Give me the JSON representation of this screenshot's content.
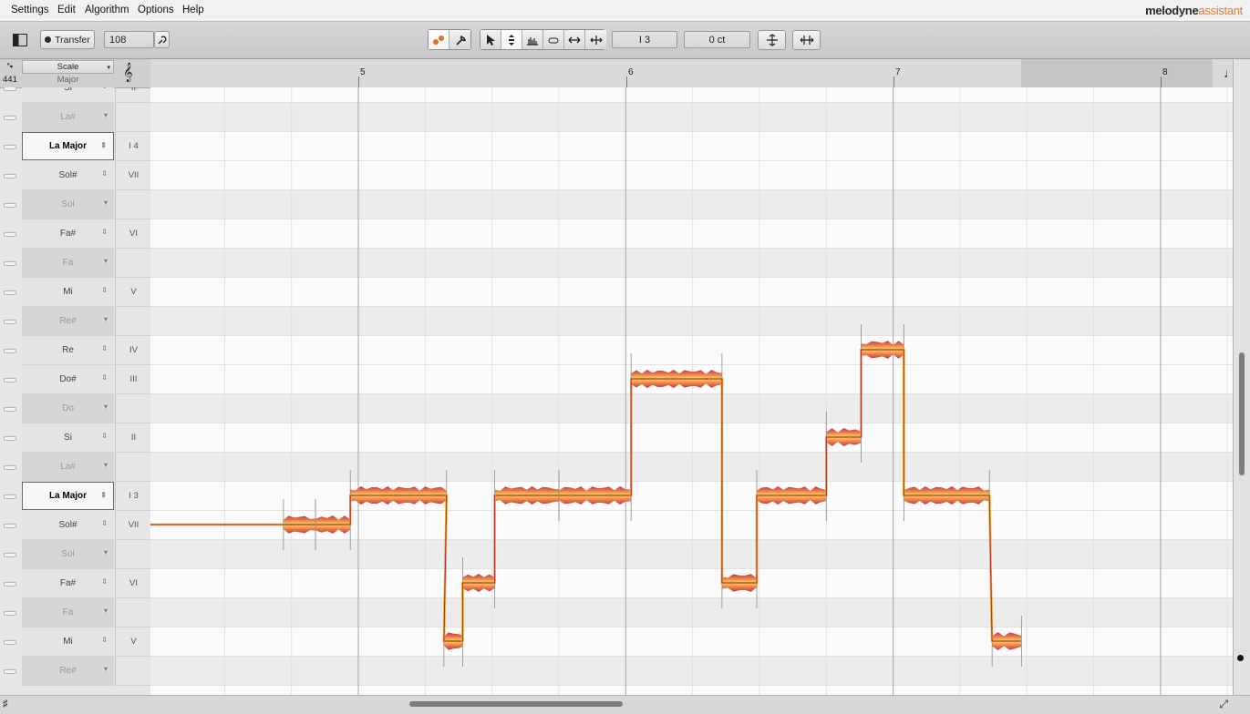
{
  "menu": [
    "Settings",
    "Edit",
    "Algorithm",
    "Options",
    "Help"
  ],
  "brand": {
    "name": "melodyne",
    "edition": "assistant"
  },
  "toolbar": {
    "transfer_label": "Transfer",
    "tempo": "108",
    "pitch_readout": "I 3",
    "cents_readout": "0 ct",
    "tools": [
      "pitch-tool-icon",
      "macro-tool-icon",
      "pointer-tool-icon",
      "pitch-edit-tool-icon",
      "amplitude-tool-icon",
      "note-separation-tool-icon",
      "time-tool-icon",
      "time-handle-tool-icon"
    ]
  },
  "scale_panel": {
    "header_label": "Scale",
    "reference_pitch": "441",
    "scale_name": "Major",
    "rows": [
      {
        "note": "Si",
        "degree": "II",
        "in_scale": true
      },
      {
        "note": "La#",
        "degree": "",
        "in_scale": false
      },
      {
        "note": "La Major",
        "degree": "I 4",
        "in_scale": true,
        "tonic": true
      },
      {
        "note": "Sol#",
        "degree": "VII",
        "in_scale": true
      },
      {
        "note": "Sol",
        "degree": "",
        "in_scale": false
      },
      {
        "note": "Fa#",
        "degree": "VI",
        "in_scale": true
      },
      {
        "note": "Fa",
        "degree": "",
        "in_scale": false
      },
      {
        "note": "Mi",
        "degree": "V",
        "in_scale": true
      },
      {
        "note": "Re#",
        "degree": "",
        "in_scale": false
      },
      {
        "note": "Re",
        "degree": "IV",
        "in_scale": true
      },
      {
        "note": "Do#",
        "degree": "III",
        "in_scale": true
      },
      {
        "note": "Do",
        "degree": "",
        "in_scale": false
      },
      {
        "note": "Si",
        "degree": "II",
        "in_scale": true
      },
      {
        "note": "La#",
        "degree": "",
        "in_scale": false
      },
      {
        "note": "La Major",
        "degree": "I 3",
        "in_scale": true,
        "tonic": true
      },
      {
        "note": "Sol#",
        "degree": "VII",
        "in_scale": true
      },
      {
        "note": "Sol",
        "degree": "",
        "in_scale": false
      },
      {
        "note": "Fa#",
        "degree": "VI",
        "in_scale": true
      },
      {
        "note": "Fa",
        "degree": "",
        "in_scale": false
      },
      {
        "note": "Mi",
        "degree": "V",
        "in_scale": true
      },
      {
        "note": "Re#",
        "degree": "",
        "in_scale": false
      }
    ]
  },
  "ruler": {
    "bars": [
      "5",
      "6",
      "7",
      "8"
    ]
  },
  "notes": [
    {
      "pitch": "Sol#",
      "start_bar": 4.72,
      "end_bar": 4.84
    },
    {
      "pitch": "Sol#",
      "start_bar": 4.84,
      "end_bar": 4.97
    },
    {
      "pitch": "La",
      "start_bar": 4.97,
      "end_bar": 5.33
    },
    {
      "pitch": "Mi",
      "start_bar": 5.32,
      "end_bar": 5.39
    },
    {
      "pitch": "Fa#",
      "start_bar": 5.39,
      "end_bar": 5.51
    },
    {
      "pitch": "La",
      "start_bar": 5.51,
      "end_bar": 5.75
    },
    {
      "pitch": "La",
      "start_bar": 5.75,
      "end_bar": 6.02
    },
    {
      "pitch": "Do#",
      "start_bar": 6.02,
      "end_bar": 6.36
    },
    {
      "pitch": "Fa#",
      "start_bar": 6.36,
      "end_bar": 6.49
    },
    {
      "pitch": "La",
      "start_bar": 6.49,
      "end_bar": 6.75
    },
    {
      "pitch": "Si",
      "start_bar": 6.75,
      "end_bar": 6.88
    },
    {
      "pitch": "Re",
      "start_bar": 6.88,
      "end_bar": 7.04
    },
    {
      "pitch": "La",
      "start_bar": 7.04,
      "end_bar": 7.36
    },
    {
      "pitch": "Mi",
      "start_bar": 7.37,
      "end_bar": 7.48
    }
  ]
}
